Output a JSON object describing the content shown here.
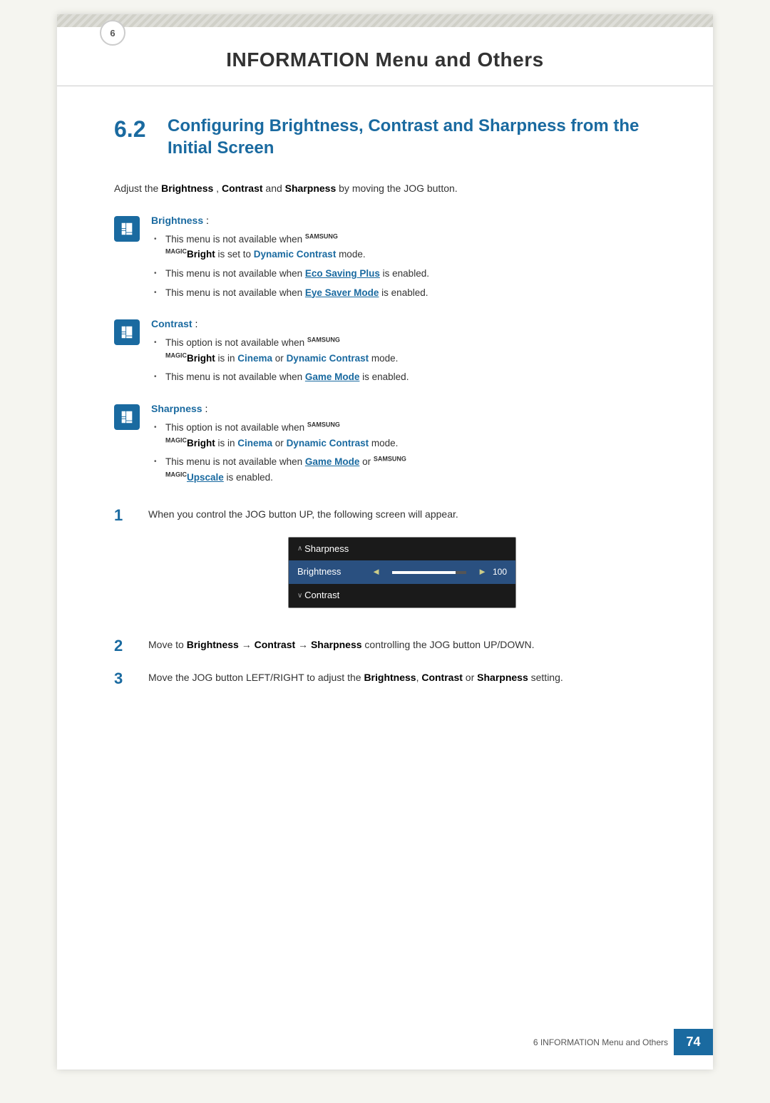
{
  "header": {
    "title": "INFORMATION Menu and Others",
    "chapter_num": "6"
  },
  "section": {
    "number": "6.2",
    "title": "Configuring Brightness, Contrast and Sharpness from the Initial Screen"
  },
  "intro": {
    "text_before": "Adjust the ",
    "brightness": "Brightness",
    "comma1": ",",
    "contrast": "Contrast",
    "and_text": " and ",
    "sharpness": "Sharpness",
    "text_after": " by moving the JOG button."
  },
  "items": [
    {
      "label": "Brightness",
      "colon": " :",
      "bullets": [
        {
          "prefix": "This menu is not available when ",
          "brand_tag": "SAMSUNG MAGIC",
          "bold_word": "Bright",
          "suffix_before": " is set to ",
          "highlight": "Dynamic Contrast",
          "suffix": " mode."
        },
        {
          "prefix": "This menu is not available when ",
          "link": "Eco Saving Plus",
          "suffix": " is enabled."
        },
        {
          "prefix": "This menu is not available when ",
          "link": "Eye Saver Mode",
          "suffix": " is enabled."
        }
      ]
    },
    {
      "label": "Contrast",
      "colon": " :",
      "bullets": [
        {
          "prefix": "This option is not available when ",
          "brand_tag": "SAMSUNG MAGIC",
          "bold_word": "Bright",
          "suffix_before": " is in ",
          "highlight1": "Cinema",
          "or_text": " or ",
          "highlight2": "Dynamic Contrast",
          "suffix": " mode."
        },
        {
          "prefix": "This menu is not available when ",
          "link": "Game Mode",
          "suffix": " is enabled."
        }
      ]
    },
    {
      "label": "Sharpness",
      "colon": " :",
      "bullets": [
        {
          "prefix": "This option is not available when ",
          "brand_tag": "SAMSUNG MAGIC",
          "bold_word": "Bright",
          "suffix_before": " is in ",
          "highlight1": "Cinema",
          "or_text": " or ",
          "highlight2": "Dynamic Contrast",
          "suffix": " mode."
        },
        {
          "prefix": "This menu is not available when ",
          "link": "Game Mode",
          "or_text": " or ",
          "brand_tag2": "SAMSUNG MAGIC",
          "link2": "Upscale",
          "suffix": " is enabled."
        }
      ]
    }
  ],
  "steps": [
    {
      "number": "1",
      "text": "When you control the JOG button UP, the following screen will appear."
    },
    {
      "number": "2",
      "text_before": "Move to ",
      "b1": "Brightness",
      "arrow1": " → ",
      "b2": "Contrast",
      "arrow2": " → ",
      "b3": "Sharpness",
      "text_after": " controlling the JOG button UP/DOWN."
    },
    {
      "number": "3",
      "text_before": "Move the JOG button LEFT/RIGHT to adjust the ",
      "b1": "Brightness",
      "comma": ", ",
      "b2": "Contrast",
      "or_text": " or ",
      "b3": "Sharpness",
      "text_after": " setting."
    }
  ],
  "osd": {
    "rows": [
      {
        "type": "chevron-up",
        "label": "Sharpness",
        "active": false
      },
      {
        "type": "slider",
        "label": "Brightness",
        "value": "100",
        "bar_pct": 85,
        "active": true
      },
      {
        "type": "chevron-down",
        "label": "Contrast",
        "active": false
      }
    ]
  },
  "footer": {
    "text": "6 INFORMATION Menu and Others",
    "page": "74"
  }
}
